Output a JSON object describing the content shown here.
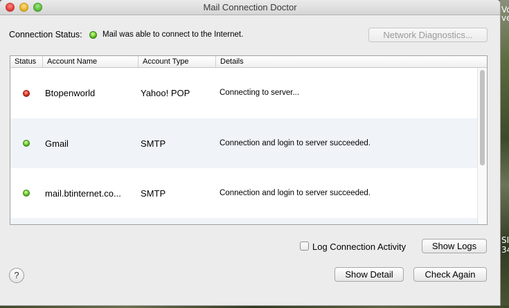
{
  "window": {
    "title": "Mail Connection Doctor"
  },
  "connection": {
    "label": "Connection Status:",
    "status_color": "#5fbf3a",
    "message": "Mail was able to connect to the Internet."
  },
  "buttons": {
    "network_diagnostics": "Network Diagnostics...",
    "show_logs": "Show Logs",
    "show_detail": "Show Detail",
    "check_again": "Check Again",
    "help": "?"
  },
  "table": {
    "columns": [
      "Status",
      "Account Name",
      "Account Type",
      "Details"
    ],
    "rows": [
      {
        "status": "red",
        "account_name": "Btopenworld",
        "account_type": "Yahoo! POP",
        "details": "Connecting to server..."
      },
      {
        "status": "green",
        "account_name": "Gmail",
        "account_type": "SMTP",
        "details": "Connection and login to server succeeded."
      },
      {
        "status": "green",
        "account_name": "mail.btinternet.co...",
        "account_type": "SMTP",
        "details": "Connection and login to server succeeded."
      }
    ]
  },
  "options": {
    "log_activity_label": "Log Connection Activity",
    "log_activity_checked": false
  },
  "desktop": {
    "fragments": [
      "Vo",
      "ve",
      "SI",
      "34"
    ]
  }
}
